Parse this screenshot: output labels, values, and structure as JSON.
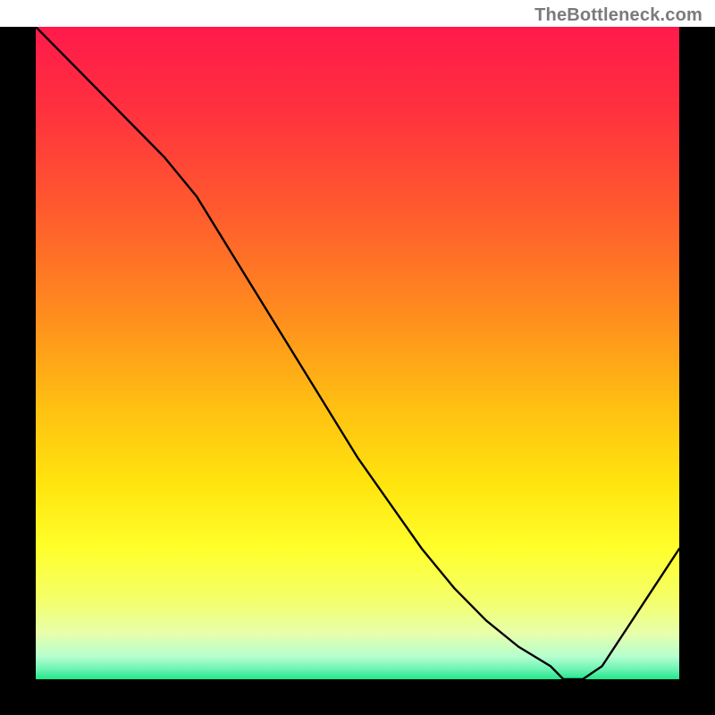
{
  "attribution": "TheBottleneck.com",
  "marker_label": "",
  "gradient_stops": [
    {
      "offset": 0,
      "color": "#ff1a4b"
    },
    {
      "offset": 0.12,
      "color": "#ff2f3f"
    },
    {
      "offset": 0.28,
      "color": "#ff5a2e"
    },
    {
      "offset": 0.44,
      "color": "#ff8c1e"
    },
    {
      "offset": 0.58,
      "color": "#ffbf12"
    },
    {
      "offset": 0.7,
      "color": "#ffe40e"
    },
    {
      "offset": 0.8,
      "color": "#ffff2b"
    },
    {
      "offset": 0.88,
      "color": "#f4ff6b"
    },
    {
      "offset": 0.93,
      "color": "#e7ffab"
    },
    {
      "offset": 0.965,
      "color": "#b6ffcf"
    },
    {
      "offset": 0.985,
      "color": "#6cf3b4"
    },
    {
      "offset": 1.0,
      "color": "#1fe889"
    }
  ],
  "chart_data": {
    "type": "line",
    "title": "",
    "xlabel": "",
    "ylabel": "",
    "xlim": [
      0,
      100
    ],
    "ylim": [
      0,
      100
    ],
    "series": [
      {
        "name": "curve",
        "x": [
          0,
          5,
          10,
          15,
          20,
          25,
          30,
          35,
          40,
          45,
          50,
          55,
          60,
          65,
          70,
          75,
          80,
          82,
          85,
          88,
          92,
          96,
          100
        ],
        "y": [
          100,
          95,
          90,
          85,
          80,
          74,
          66,
          58,
          50,
          42,
          34,
          27,
          20,
          14,
          9,
          5,
          2,
          0,
          0,
          2,
          8,
          14,
          20
        ]
      }
    ],
    "annotations": [
      {
        "text": "",
        "x": 82,
        "y": 1
      }
    ]
  }
}
